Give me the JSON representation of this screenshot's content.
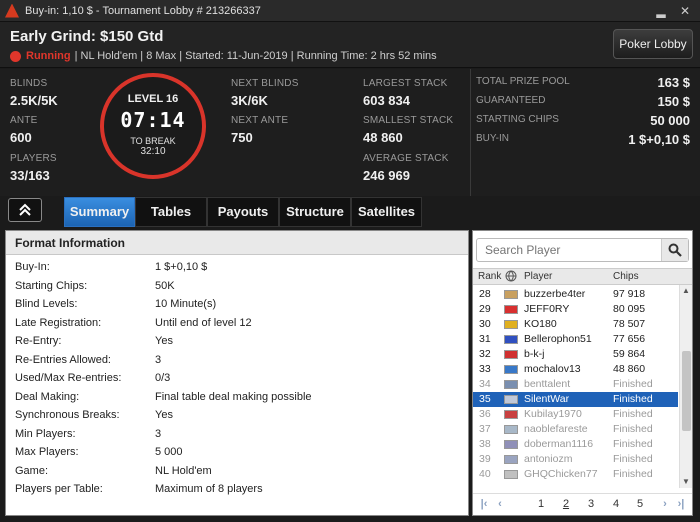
{
  "window": {
    "title": "Buy-in: 1,10 $ - Tournament Lobby # 213266337",
    "minimize_glyph": "▂",
    "close_glyph": "✕"
  },
  "header": {
    "tournament_name": "Early Grind: $150 Gtd",
    "status": "Running",
    "details": "| NL Hold'em | 8 Max | Started: 11-Jun-2019 | Running Time: 2 hrs  52 mins",
    "lobby_button": "Poker Lobby"
  },
  "stats": {
    "blinds_label": "BLINDS",
    "blinds": "2.5K/5K",
    "ante_label": "ANTE",
    "ante": "600",
    "players_label": "PLAYERS",
    "players": "33/163",
    "level": "LEVEL 16",
    "clock": "07:14",
    "to_break_label": "TO BREAK",
    "to_break": "32:10",
    "next_blinds_label": "NEXT BLINDS",
    "next_blinds": "3K/6K",
    "next_ante_label": "NEXT ANTE",
    "next_ante": "750",
    "largest_stack_label": "LARGEST STACK",
    "largest_stack": "603 834",
    "smallest_stack_label": "SMALLEST STACK",
    "smallest_stack": "48 860",
    "average_stack_label": "AVERAGE STACK",
    "average_stack": "246 969"
  },
  "prize": {
    "total_prize_pool_label": "TOTAL PRIZE POOL",
    "total_prize_pool": "163 $",
    "guaranteed_label": "GUARANTEED",
    "guaranteed": "150 $",
    "starting_chips_label": "STARTING CHIPS",
    "starting_chips": "50 000",
    "buy_in_label": "BUY-IN",
    "buy_in": "1 $+0,10 $"
  },
  "tabs": [
    "Summary",
    "Tables",
    "Payouts",
    "Structure",
    "Satellites"
  ],
  "format": {
    "heading": "Format Information",
    "rows": [
      {
        "k": "Buy-In:",
        "v": "1 $+0,10 $"
      },
      {
        "k": "Starting Chips:",
        "v": "50K"
      },
      {
        "k": "Blind Levels:",
        "v": "10 Minute(s)"
      },
      {
        "k": "Late Registration:",
        "v": "Until end of level 12"
      },
      {
        "k": "Re-Entry:",
        "v": "Yes"
      },
      {
        "k": "Re-Entries Allowed:",
        "v": "3"
      },
      {
        "k": "Used/Max Re-entries:",
        "v": "0/3"
      },
      {
        "k": "Deal Making:",
        "v": "Final table deal making possible"
      },
      {
        "k": "Synchronous Breaks:",
        "v": "Yes"
      },
      {
        "k": "Min Players:",
        "v": "3"
      },
      {
        "k": "Max Players:",
        "v": "5 000"
      },
      {
        "k": "Game:",
        "v": "NL Hold'em"
      },
      {
        "k": "Players per Table:",
        "v": "Maximum of 8 players"
      }
    ]
  },
  "players_panel": {
    "search_placeholder": "Search Player",
    "col_rank": "Rank",
    "col_player": "Player",
    "col_chips": "Chips",
    "rows": [
      {
        "rank": "28",
        "name": "buzzerbe4ter",
        "chips": "97 918",
        "flag_color": "#c8a060",
        "finished": false
      },
      {
        "rank": "29",
        "name": "JEFF0RY",
        "chips": "80 095",
        "flag_color": "#d83030",
        "finished": false
      },
      {
        "rank": "30",
        "name": "KO180",
        "chips": "78 507",
        "flag_color": "#e0b020",
        "finished": false
      },
      {
        "rank": "31",
        "name": "Bellerophon51",
        "chips": "77 656",
        "flag_color": "#3050c0",
        "finished": false
      },
      {
        "rank": "32",
        "name": "b-k-j",
        "chips": "59 864",
        "flag_color": "#d03030",
        "finished": false
      },
      {
        "rank": "33",
        "name": "mochalov13",
        "chips": "48 860",
        "flag_color": "#3878c8",
        "finished": false
      },
      {
        "rank": "34",
        "name": "benttalent",
        "chips": "Finished",
        "flag_color": "#7a8fb0",
        "finished": true
      },
      {
        "rank": "35",
        "name": "SilentWar",
        "chips": "Finished",
        "flag_color": "#c0c8d8",
        "finished": true,
        "selected": true
      },
      {
        "rank": "36",
        "name": "Kubilay1970",
        "chips": "Finished",
        "flag_color": "#c84040",
        "finished": true
      },
      {
        "rank": "37",
        "name": "naoblefareste",
        "chips": "Finished",
        "flag_color": "#a8b8c8",
        "finished": true
      },
      {
        "rank": "38",
        "name": "doberman1116",
        "chips": "Finished",
        "flag_color": "#9090b8",
        "finished": true
      },
      {
        "rank": "39",
        "name": "antoniozm",
        "chips": "Finished",
        "flag_color": "#9aa4c0",
        "finished": true
      },
      {
        "rank": "40",
        "name": "GHQChicken77",
        "chips": "Finished",
        "flag_color": "#c0c0c0",
        "finished": true
      }
    ],
    "pager": {
      "first": "|‹",
      "prev": "‹",
      "pages": [
        "1",
        "2",
        "3",
        "4",
        "5"
      ],
      "current": "2",
      "next": "›",
      "last": "›|"
    }
  },
  "colors": {
    "accent_blue": "#1f62b8",
    "running_red": "#e0362b"
  }
}
